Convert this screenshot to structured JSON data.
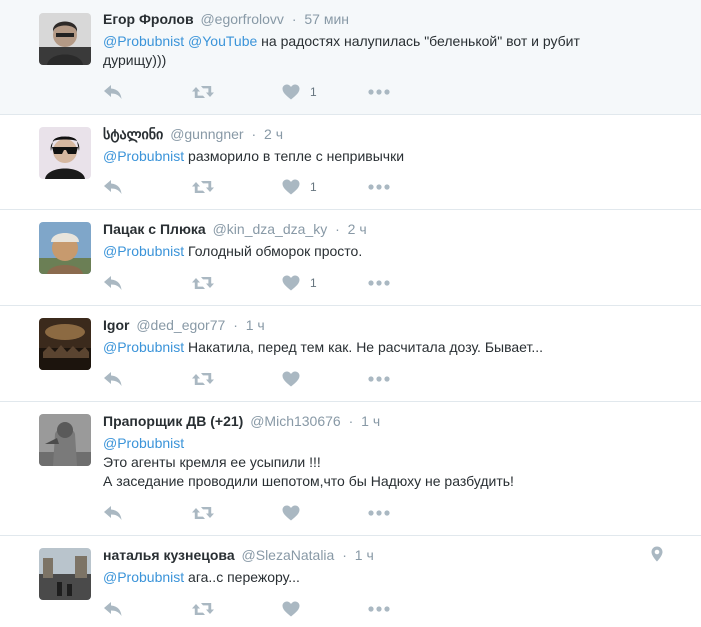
{
  "tweets": [
    {
      "fullname": "Егор Фролов",
      "username": "@egorfrolovv",
      "time": "57 мин",
      "mention1": "@Probubnist",
      "mention2": "@YouTube",
      "text": "на радостях налупилась \"беленькой\" вот и рубит",
      "text2": "дурищу)))",
      "likes": "1"
    },
    {
      "fullname": "სტალინი",
      "username": "@gunngner",
      "time": "2 ч",
      "mention1": "@Probubnist",
      "text": "разморило в тепле с непривычки",
      "likes": "1"
    },
    {
      "fullname": "Пацак с Плюка",
      "username": "@kin_dza_dza_ky",
      "time": "2 ч",
      "mention1": "@Probubnist",
      "text": "Голодный обморок просто.",
      "likes": "1"
    },
    {
      "fullname": "Igor",
      "username": "@ded_egor77",
      "time": "1 ч",
      "mention1": "@Probubnist",
      "text": "Накатила, перед тем как. Не расчитала дозу. Бывает..."
    },
    {
      "fullname": "Прапорщик ДВ (+21)",
      "username": "@Mich130676",
      "time": "1 ч",
      "mention1": "@Probubnist",
      "line2": "Это агенты кремля ее усыпили !!!",
      "line3": "А заседание проводили шепотом,что бы Надюху не разбудить!"
    },
    {
      "fullname": "наталья кузнецова",
      "username": "@SlezaNatalia",
      "time": "1 ч",
      "mention1": "@Probubnist",
      "text": "ага..с пережору..."
    }
  ],
  "separator": "·",
  "icons": [
    "reply-icon",
    "retweet-icon",
    "heart-icon",
    "more-icon",
    "location-pin-icon"
  ],
  "colors": {
    "mention": "#3b94d9",
    "meta": "#8899a6",
    "icon": "#aab8c2",
    "highlight_bg": "#f5f8fa"
  }
}
